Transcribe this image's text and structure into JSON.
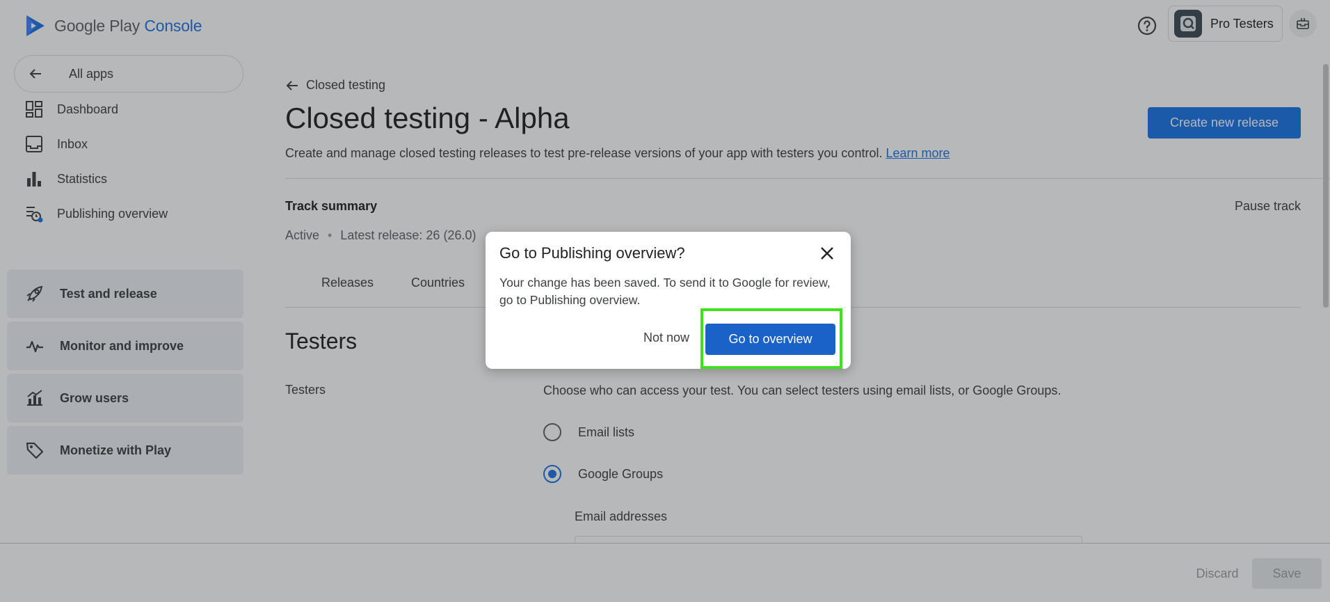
{
  "app": {
    "logo_text_primary": "Google Play",
    "logo_text_secondary": "Console",
    "account_name": "Pro Testers"
  },
  "sidebar": {
    "all_apps_label": "All apps",
    "items": [
      {
        "label": "Dashboard",
        "icon": "dashboard-icon"
      },
      {
        "label": "Inbox",
        "icon": "inbox-icon"
      },
      {
        "label": "Statistics",
        "icon": "bar-chart-icon"
      },
      {
        "label": "Publishing overview",
        "icon": "publishing-overview-icon"
      }
    ],
    "sections": [
      {
        "label": "Test and release",
        "icon": "rocket-icon"
      },
      {
        "label": "Monitor and improve",
        "icon": "pulse-icon"
      },
      {
        "label": "Grow users",
        "icon": "grow-icon"
      },
      {
        "label": "Monetize with Play",
        "icon": "tag-icon"
      }
    ]
  },
  "main": {
    "back_link": "Closed testing",
    "title": "Closed testing - Alpha",
    "description": "Create and manage closed testing releases to test pre-release versions of your app with testers you control.",
    "learn_more": "Learn more",
    "create_release_label": "Create new release",
    "track_summary_label": "Track summary",
    "pause_track_label": "Pause track",
    "status": {
      "state": "Active",
      "latest_release": "Latest release: 26 (26.0)"
    },
    "tabs": [
      "Releases",
      "Countries"
    ],
    "testers_title": "Testers",
    "testers_label": "Testers",
    "testers_desc": "Choose who can access your test. You can select testers using email lists, or Google Groups.",
    "options": [
      {
        "label": "Email lists",
        "selected": false
      },
      {
        "label": "Google Groups",
        "selected": true
      }
    ],
    "email_addresses_label": "Email addresses"
  },
  "bottombar": {
    "discard_label": "Discard",
    "save_label": "Save"
  },
  "dialog": {
    "title": "Go to Publishing overview?",
    "body": "Your change has been saved. To send it to Google for review, go to Publishing overview.",
    "not_now_label": "Not now",
    "go_label": "Go to overview"
  },
  "colors": {
    "accent": "#1a73e8",
    "dialog_button": "#1a62c7",
    "highlight": "#3ee21c"
  }
}
